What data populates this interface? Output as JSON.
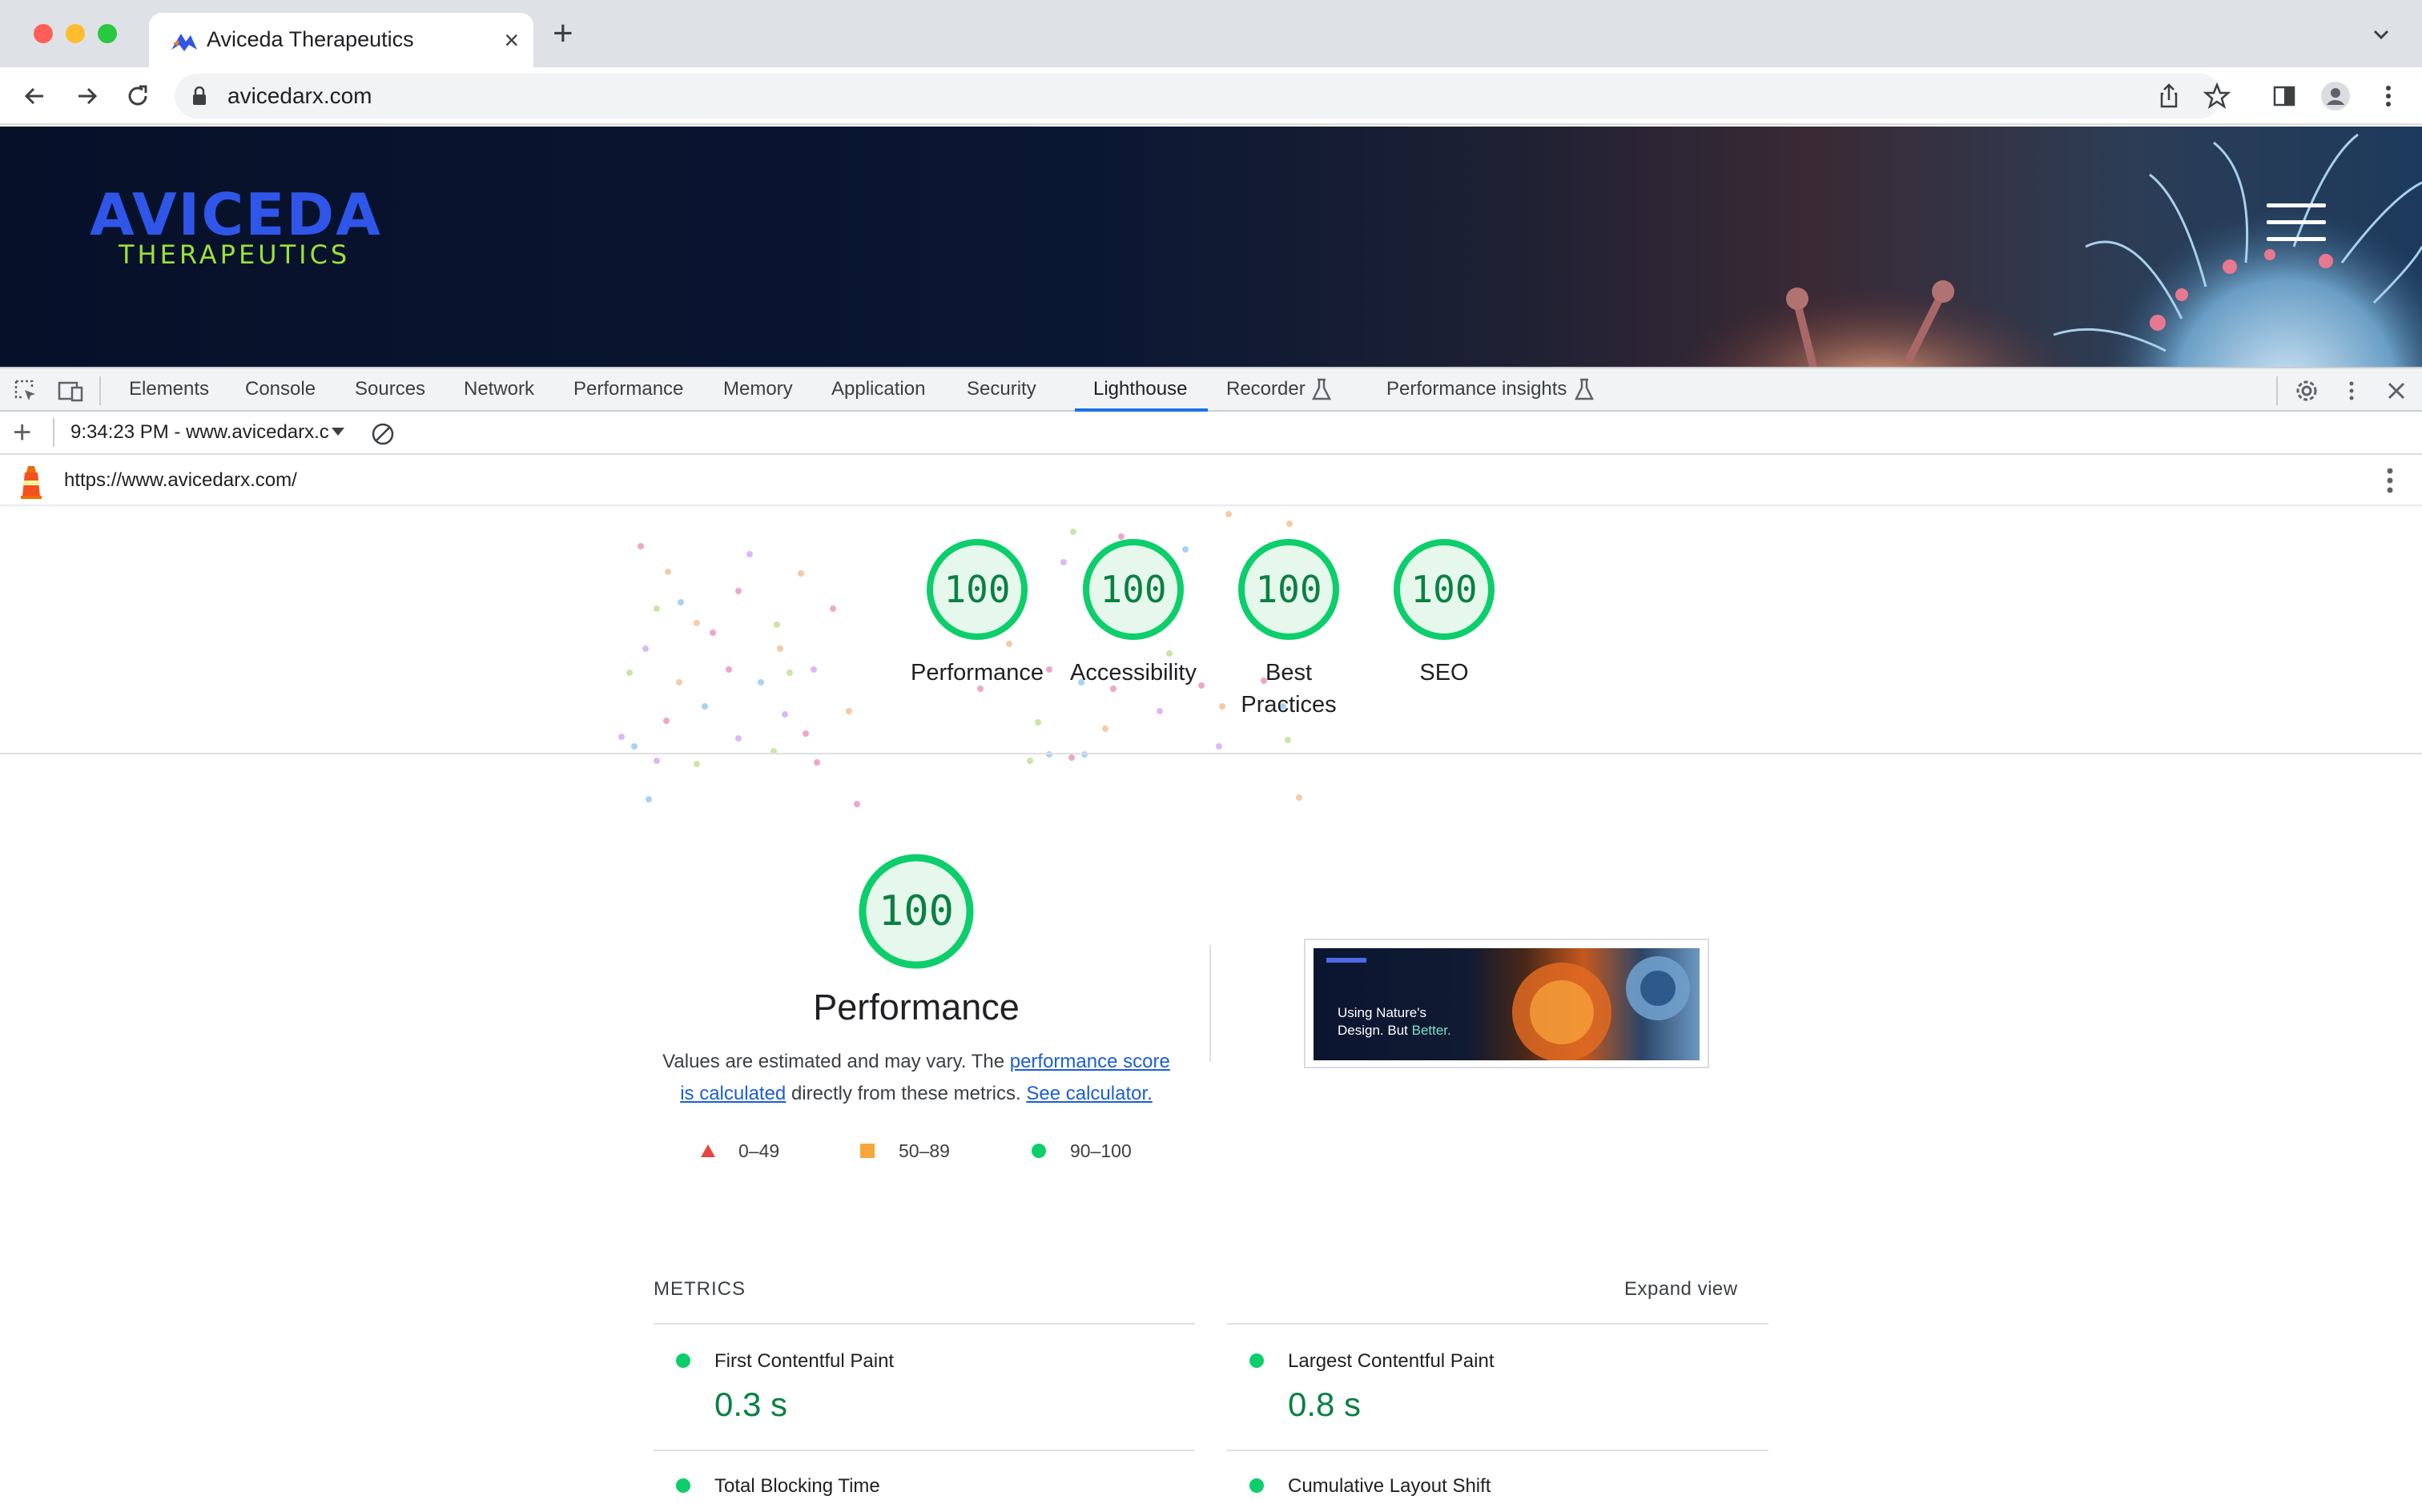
{
  "browser": {
    "tab_title": "Aviceda Therapeutics",
    "tab_close": "×",
    "new_tab": "+",
    "address": "avicedarx.com"
  },
  "site": {
    "logo_main": "AVICEDA",
    "logo_sub": "THERAPEUTICS"
  },
  "devtools": {
    "tabs": [
      "Elements",
      "Console",
      "Sources",
      "Network",
      "Performance",
      "Memory",
      "Application",
      "Security",
      "Lighthouse",
      "Recorder",
      "Performance insights"
    ],
    "active_tab": "Lighthouse",
    "accent": "#1a73e8"
  },
  "lighthouse": {
    "new_report": "+",
    "report_selector": "9:34:23 PM - www.avicedarx.c",
    "url": "https://www.avicedarx.com/",
    "gauge_color": "#0cce6b",
    "scores": [
      {
        "label": "Performance",
        "value": "100"
      },
      {
        "label": "Accessibility",
        "value": "100"
      },
      {
        "label": "Best Practices",
        "value": "100"
      },
      {
        "label": "SEO",
        "value": "100"
      }
    ],
    "performance": {
      "score": "100",
      "title": "Performance",
      "desc_1": "Values are estimated and may vary. The ",
      "desc_link_1": "performance score is calculated",
      "desc_2": " directly from these metrics. ",
      "desc_link_2": "See calculator."
    },
    "legend": [
      {
        "label": "0–49",
        "color": "#e8453c",
        "shape": "triangle"
      },
      {
        "label": "50–89",
        "color": "#f4a83a",
        "shape": "square"
      },
      {
        "label": "90–100",
        "color": "#0cce6b",
        "shape": "circle"
      }
    ],
    "screenshot_text_1": "Using Nature's",
    "screenshot_text_2": "Design. But ",
    "screenshot_text_3": "Better.",
    "metrics_heading": "METRICS",
    "expand_view": "Expand view",
    "metrics": [
      {
        "name": "First Contentful Paint",
        "value": "0.3 s"
      },
      {
        "name": "Largest Contentful Paint",
        "value": "0.8 s"
      },
      {
        "name": "Total Blocking Time",
        "value": ""
      },
      {
        "name": "Cumulative Layout Shift",
        "value": ""
      }
    ]
  }
}
